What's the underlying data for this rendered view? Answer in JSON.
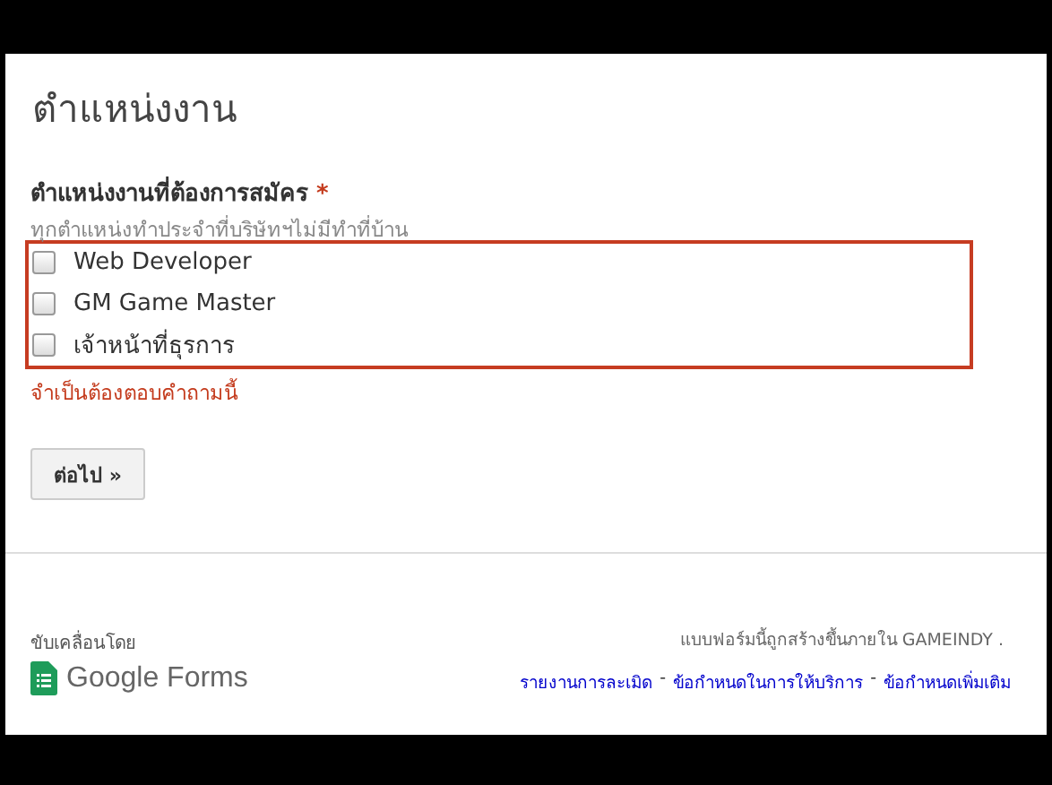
{
  "form_title": "ตำแหน่งงาน",
  "question": {
    "label": "ตำแหน่งงานที่ต้องการสมัคร",
    "required_mark": "*",
    "help": "ทุกตำแหน่งทำประจำที่บริษัทฯไม่มีทำที่บ้าน",
    "error": true,
    "options": [
      {
        "label": "Web Developer",
        "checked": false
      },
      {
        "label": "GM Game Master",
        "checked": false
      },
      {
        "label": "เจ้าหน้าที่ธุรการ",
        "checked": false
      }
    ],
    "error_message": "จำเป็นต้องตอบคำถามนี้"
  },
  "next_button": "ต่อไป »",
  "footer": {
    "powered_by": "ขับเคลื่อนโดย",
    "logo_text": "Google Forms",
    "created_note": "แบบฟอร์มนี้ถูกสร้างขึ้นภายใน GAMEINDY .",
    "links": [
      {
        "label": "รายงานการละเมิด"
      },
      {
        "label": "ข้อกำหนดในการให้บริการ"
      },
      {
        "label": "ข้อกำหนดเพิ่มเติม"
      }
    ],
    "link_separator": "-"
  }
}
